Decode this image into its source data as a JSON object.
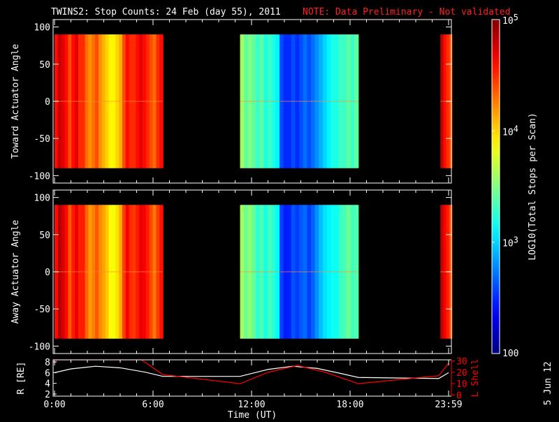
{
  "title": "TWINS2: Stop Counts: 24 Feb (day  55), 2011",
  "note": "NOTE: Data Preliminary - Not validated",
  "colors": {
    "note": "#ff2020",
    "lshell": "#ff0000",
    "radius": "#ffffff"
  },
  "date_stamp": "5 Jun 12",
  "chart_data": {
    "type": "heatmap",
    "xlabel": "Time (UT)",
    "x_ticks": [
      {
        "h": 0,
        "label": "0:00"
      },
      {
        "h": 6,
        "label": "6:00"
      },
      {
        "h": 12,
        "label": "12:00"
      },
      {
        "h": 18,
        "label": "18:00"
      },
      {
        "h": 24,
        "label": "23:59"
      }
    ],
    "xlim": [
      0,
      24
    ],
    "panels": [
      {
        "ylabel": "Toward Actuator Angle",
        "ylim": [
          -110,
          110
        ],
        "y_ticks": [
          "100",
          "50",
          "0",
          "-50",
          "-100"
        ],
        "y_tick_values": [
          100,
          50,
          0,
          -50,
          -100
        ]
      },
      {
        "ylabel": "Away Actuator Angle",
        "ylim": [
          -110,
          110
        ],
        "y_ticks": [
          "100",
          "50",
          "0",
          "-50",
          "-100"
        ],
        "y_tick_values": [
          100,
          50,
          0,
          -50,
          -100
        ]
      }
    ],
    "angle_range": [
      -90,
      90
    ],
    "segments": [
      {
        "start_h": 0,
        "end_h": 6.6,
        "log_counts": [
          4.6,
          4.8,
          4.7,
          4.6,
          4.4,
          4.6,
          4.7,
          4.5,
          4.5,
          4.3,
          4.2,
          4.3,
          4.4,
          4.2,
          4.1,
          4.0,
          3.9,
          3.9,
          4.0,
          4.1,
          4.4,
          4.6,
          4.5,
          4.5,
          4.6,
          4.7,
          4.6,
          4.5,
          4.4,
          4.3,
          4.5,
          4.6
        ]
      },
      {
        "start_h": 11.3,
        "end_h": 18.5,
        "log_counts": [
          3.6,
          3.4,
          3.5,
          3.4,
          3.3,
          3.4,
          3.2,
          3.3,
          3.2,
          3.1,
          2.6,
          2.5,
          2.5,
          2.6,
          2.5,
          2.6,
          2.7,
          2.6,
          2.7,
          2.8,
          2.9,
          3.0,
          3.1,
          3.2,
          3.2,
          3.3,
          3.3,
          3.4,
          3.3,
          3.4
        ]
      },
      {
        "start_h": 23.5,
        "end_h": 24.2,
        "log_counts": [
          4.8,
          4.6,
          4.5,
          4.4
        ]
      }
    ],
    "colorbar": {
      "label": "LOG10(Total Stops per Scan)",
      "range_log": [
        2,
        5
      ],
      "ticks": [
        {
          "v": 5,
          "base": "10",
          "exp": "5"
        },
        {
          "v": 4,
          "base": "10",
          "exp": "4"
        },
        {
          "v": 3,
          "base": "10",
          "exp": "3"
        },
        {
          "v": 2,
          "base": "100",
          "exp": ""
        }
      ]
    },
    "orbit": {
      "left_label": "R [RE]",
      "right_label": "L Shell",
      "r_ticks": [
        "8",
        "6",
        "4",
        "2"
      ],
      "r_tick_values": [
        8,
        6,
        4,
        2
      ],
      "r_range": [
        1.6,
        8.4
      ],
      "l_ticks": [
        "30",
        "20",
        "10",
        "0"
      ],
      "l_tick_values": [
        30,
        20,
        10,
        0
      ],
      "l_range": [
        -1,
        31
      ],
      "radius": [
        [
          0,
          6.0
        ],
        [
          1,
          6.7
        ],
        [
          2.5,
          7.2
        ],
        [
          4,
          6.9
        ],
        [
          5.5,
          6.1
        ],
        [
          6.6,
          5.3
        ],
        [
          11.3,
          5.3
        ],
        [
          13,
          6.6
        ],
        [
          14.5,
          7.2
        ],
        [
          16,
          6.8
        ],
        [
          17.5,
          5.8
        ],
        [
          18.5,
          5.1
        ],
        [
          23.4,
          4.9
        ],
        [
          24,
          6.0
        ]
      ],
      "lshell": [
        [
          0,
          28
        ],
        [
          0.15,
          31
        ],
        [
          5.3,
          31
        ],
        [
          6.6,
          18
        ],
        [
          11.3,
          10
        ],
        [
          13,
          20
        ],
        [
          14.8,
          26
        ],
        [
          16.5,
          20
        ],
        [
          18.5,
          10
        ],
        [
          23.4,
          17
        ],
        [
          24,
          28
        ]
      ]
    }
  }
}
